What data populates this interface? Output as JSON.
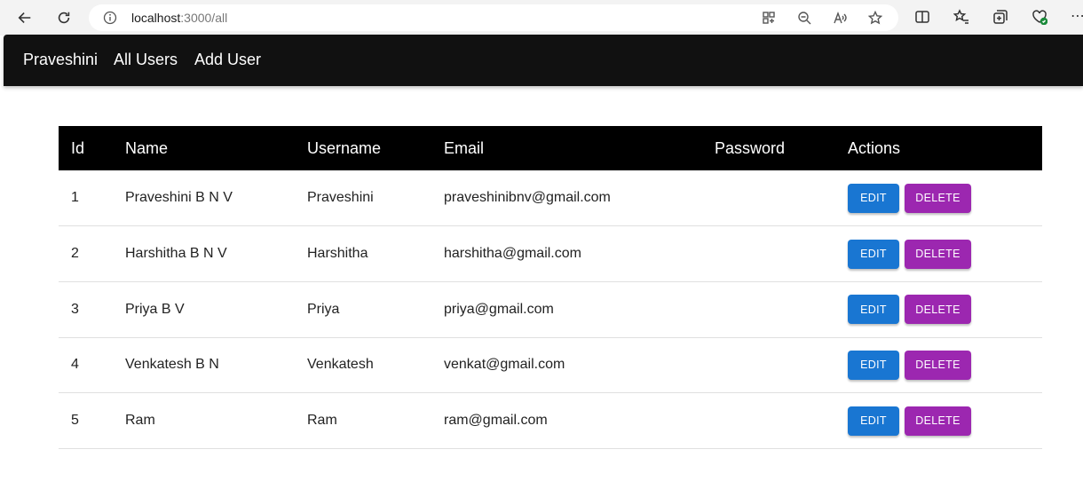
{
  "browser": {
    "url_host": "localhost",
    "url_path": ":3000/all",
    "more_label": "⋯"
  },
  "navbar": {
    "brand": "Praveshini",
    "links": [
      "All Users",
      "Add User"
    ]
  },
  "table": {
    "headers": [
      "Id",
      "Name",
      "Username",
      "Email",
      "Password",
      "Actions"
    ],
    "rows": [
      {
        "id": "1",
        "name": "Praveshini B N V",
        "username": "Praveshini",
        "email": "praveshinibnv@gmail.com",
        "password": ""
      },
      {
        "id": "2",
        "name": "Harshitha B N V",
        "username": "Harshitha",
        "email": "harshitha@gmail.com",
        "password": ""
      },
      {
        "id": "3",
        "name": "Priya B V",
        "username": "Priya",
        "email": "priya@gmail.com",
        "password": ""
      },
      {
        "id": "4",
        "name": "Venkatesh B N",
        "username": "Venkatesh",
        "email": "venkat@gmail.com",
        "password": ""
      },
      {
        "id": "5",
        "name": "Ram",
        "username": "Ram",
        "email": "ram@gmail.com",
        "password": ""
      }
    ],
    "edit_label": "EDIT",
    "delete_label": "DELETE"
  },
  "colors": {
    "navbar_bg": "#111111",
    "header_bg": "#000000",
    "edit_button": "#1976d2",
    "delete_button": "#9c27b0"
  },
  "icons": [
    "back-arrow-icon",
    "reload-icon",
    "info-icon",
    "app-available-icon",
    "zoom-icon",
    "read-aloud-icon",
    "favorite-star-icon",
    "split-screen-icon",
    "favorites-icon",
    "collections-icon",
    "browser-essentials-icon",
    "more-icon"
  ]
}
